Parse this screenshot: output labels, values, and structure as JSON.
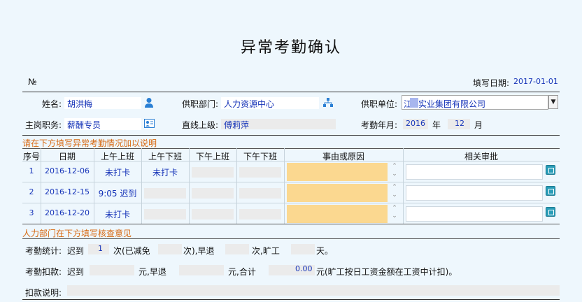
{
  "form": {
    "title": "异常考勤确认",
    "number_label": "№",
    "fill_date_label": "填写日期:",
    "fill_date": "2017-01-01"
  },
  "info": {
    "name_label": "姓名:",
    "name": "胡洪梅",
    "dept_label": "供职部门:",
    "dept": "人力资源中心",
    "unit_label": "供职单位:",
    "unit": "实业集团有限公司",
    "unit_prefix": "江",
    "post_label": "主岗职务:",
    "post": "薪酬专员",
    "superior_label": "直线上级:",
    "superior": "傅莉萍",
    "month_label": "考勤年月:",
    "year": "2016",
    "year_unit": "年",
    "month": "12",
    "month_unit": "月"
  },
  "section1_title": "请在下方填写异常考勤情况加以说明",
  "table": {
    "headers": [
      "序号",
      "日期",
      "上午上班",
      "上午下班",
      "下午上班",
      "下午下班",
      "事由或原因",
      "相关审批"
    ],
    "rows": [
      {
        "no": "1",
        "date": "2016-12-06",
        "am_in": "未打卡",
        "am_out": "未打卡",
        "pm_in": "",
        "pm_out": ""
      },
      {
        "no": "2",
        "date": "2016-12-15",
        "am_in": "9:05 迟到",
        "am_out": "",
        "pm_in": "",
        "pm_out": ""
      },
      {
        "no": "3",
        "date": "2016-12-20",
        "am_in": "未打卡",
        "am_out": "",
        "pm_in": "",
        "pm_out": ""
      }
    ]
  },
  "section2_title": "人力部门在下方填写核查意见",
  "stats": {
    "label": "考勤统计:",
    "late_label": "迟到",
    "late_count": "1",
    "times_exempt": "次(已减免",
    "early_prefix": "次),早退",
    "absent_prefix": "次,旷工",
    "days": "天。"
  },
  "deduct": {
    "label": "考勤扣款:",
    "late_label": "迟到",
    "yuan_early": "元,早退",
    "yuan_total": "元,合计",
    "total": "0.00",
    "note": "元(旷工按日工资金额在工资中计扣)。"
  },
  "explain": {
    "label": "扣款说明:"
  },
  "colors": {
    "accent": "#d86a12",
    "value": "#1533b8",
    "highlight": "#fbd890"
  }
}
